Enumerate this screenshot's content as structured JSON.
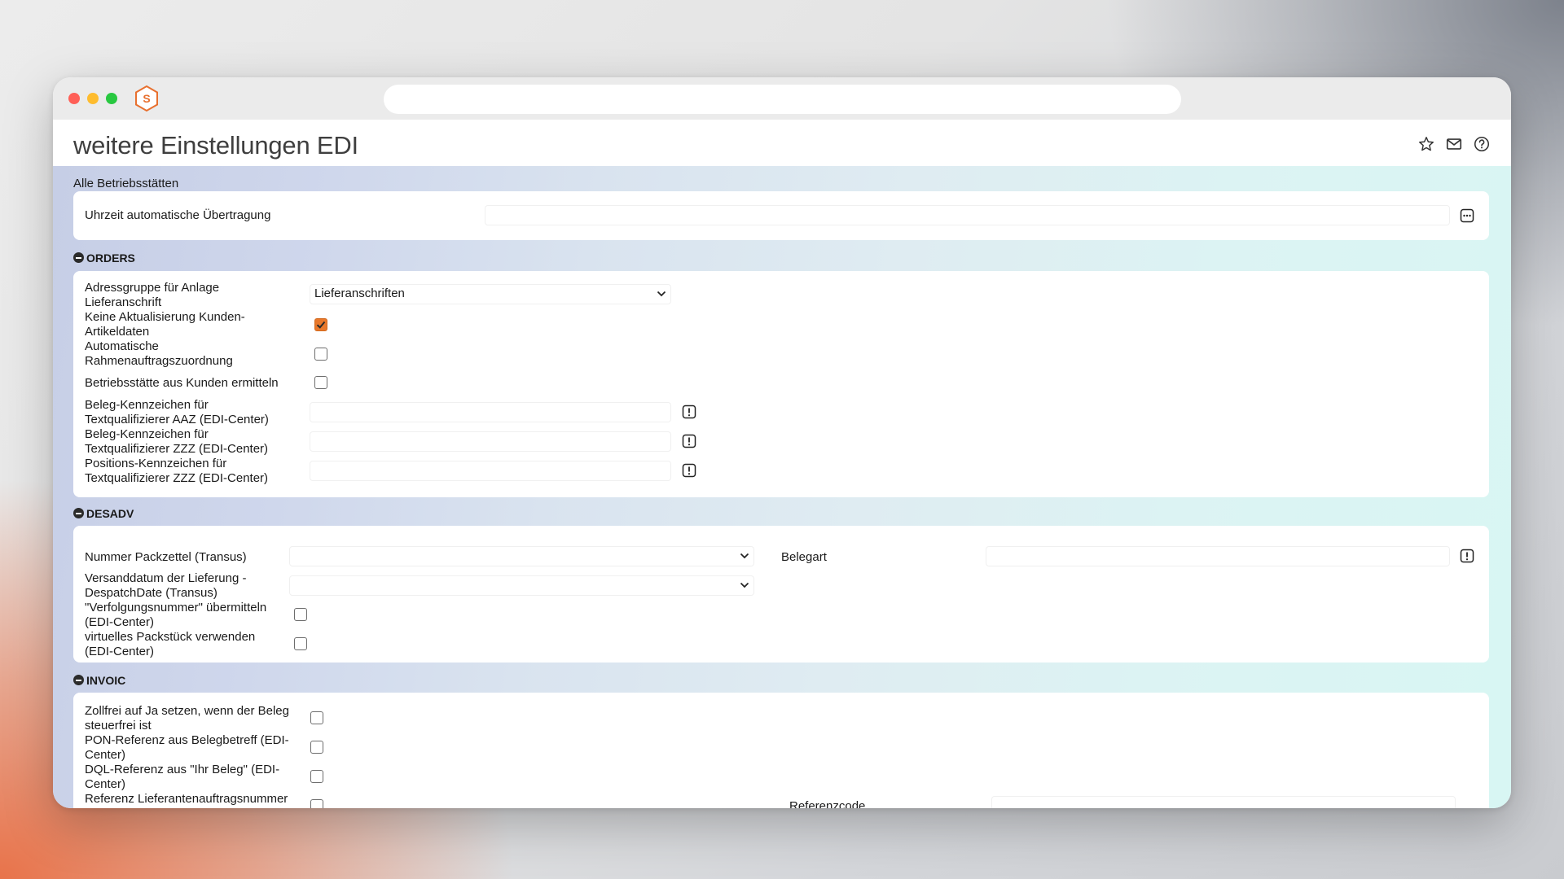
{
  "window": {
    "title": "weitere Einstellungen EDI",
    "address": ""
  },
  "header_icons": [
    "star-icon",
    "mail-icon",
    "help-icon"
  ],
  "group_label": "Alle Betriebsstätten",
  "general": {
    "uhrzeit_label": "Uhrzeit automatische Übertragung",
    "uhrzeit_value": ""
  },
  "orders": {
    "title": "ORDERS",
    "adressgruppe_label_1": "Adressgruppe für Anlage",
    "adressgruppe_label_2": "Lieferanschrift",
    "adressgruppe_value": "Lieferanschriften",
    "keine_aktualisierung_label_1": "Keine Aktualisierung Kunden-",
    "keine_aktualisierung_label_2": "Artikeldaten",
    "keine_aktualisierung_checked": true,
    "rahmenauftrag_label_1": "Automatische",
    "rahmenauftrag_label_2": "Rahmenauftragszuordnung",
    "rahmenauftrag_checked": false,
    "betriebsstaette_label": "Betriebsstätte aus Kunden ermitteln",
    "betriebsstaette_checked": false,
    "beleg_aaz_label_1": "Beleg-Kennzeichen für",
    "beleg_aaz_label_2": "Textqualifizierer AAZ (EDI-Center)",
    "beleg_aaz_value": "",
    "beleg_zzz_label_1": "Beleg-Kennzeichen für",
    "beleg_zzz_label_2": "Textqualifizierer ZZZ (EDI-Center)",
    "beleg_zzz_value": "",
    "pos_zzz_label_1": "Positions-Kennzeichen für",
    "pos_zzz_label_2": "Textqualifizierer ZZZ (EDI-Center)",
    "pos_zzz_value": ""
  },
  "desadv": {
    "title": "DESADV",
    "packzettel_label": "Nummer Packzettel (Transus)",
    "packzettel_value": "",
    "versanddatum_label_1": "Versanddatum der Lieferung -",
    "versanddatum_label_2": "DespatchDate (Transus)",
    "versanddatum_value": "",
    "verfolgung_label_1": "\"Verfolgungsnummer\" übermitteln",
    "verfolgung_label_2": "(EDI-Center)",
    "verfolgung_checked": false,
    "packstueck_label_1": "virtuelles Packstück verwenden",
    "packstueck_label_2": "(EDI-Center)",
    "packstueck_checked": false,
    "belegart_label": "Belegart",
    "belegart_value": ""
  },
  "invoic": {
    "title": "INVOIC",
    "zollfrei_label_1": "Zollfrei auf Ja setzen, wenn der Beleg",
    "zollfrei_label_2": "steuerfrei ist",
    "pon_label_1": "PON-Referenz aus Belegbetreff (EDI-",
    "pon_label_2": "Center)",
    "dql_label_1": "DQL-Referenz aus \"Ihr Beleg\" (EDI-",
    "dql_label_2": "Center)",
    "referenz_lief_label": "Referenz Lieferantenauftragsnummer",
    "referenzcode_label": "Referenzcode"
  }
}
